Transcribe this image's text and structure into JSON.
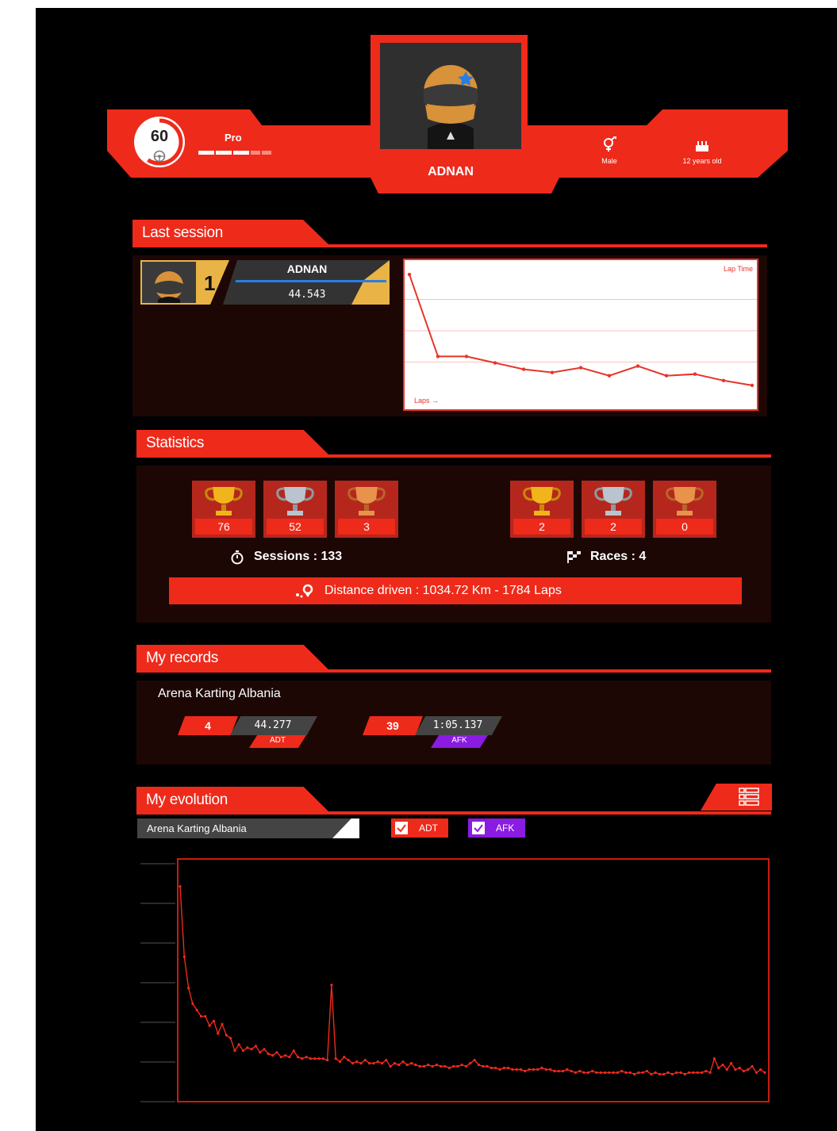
{
  "profile": {
    "name": "ADNAN",
    "level": "60",
    "rank": "Pro",
    "gender": "Male",
    "age": "12 years old"
  },
  "last_session": {
    "title": "Last session",
    "position": "1",
    "driver": "ADNAN",
    "best_lap": "44.543",
    "chart_data": {
      "type": "line",
      "ylabel": "Lap Time",
      "xlabel": "Laps",
      "x": [
        1,
        2,
        3,
        4,
        5,
        6,
        7,
        8,
        9,
        10,
        11,
        12,
        13
      ],
      "values": [
        51.8,
        46.7,
        46.7,
        46.3,
        45.9,
        45.7,
        46.0,
        45.5,
        46.1,
        45.5,
        45.6,
        45.2,
        44.9
      ],
      "ylim": [
        44.4,
        52.2
      ],
      "color": "#e8342a"
    }
  },
  "statistics": {
    "title": "Statistics",
    "sessions_trophies": [
      "76",
      "52",
      "3"
    ],
    "races_trophies": [
      "2",
      "2",
      "0"
    ],
    "sessions_label": "Sessions : 133",
    "races_label": "Races : 4",
    "distance_label": "Distance driven : 1034.72 Km - 1784 Laps"
  },
  "records": {
    "title": "My records",
    "track": "Arena Karting Albania",
    "items": [
      {
        "rank": "4",
        "time": "44.277",
        "tag": "ADT",
        "tag_color": "#ee2a1b"
      },
      {
        "rank": "39",
        "time": "1:05.137",
        "tag": "AFK",
        "tag_color": "#8a1be0"
      }
    ]
  },
  "evolution": {
    "title": "My evolution",
    "track_select": "Arena Karting Albania",
    "filters": [
      {
        "label": "ADT",
        "checked": true,
        "color": "#ee2a1b"
      },
      {
        "label": "AFK",
        "checked": true,
        "color": "#8a1be0"
      }
    ],
    "chart_data": {
      "type": "line",
      "series_color": "#ee2a1b",
      "values": [
        58.5,
        54.0,
        52.0,
        51.0,
        50.6,
        50.2,
        50.2,
        49.6,
        49.9,
        49.1,
        49.7,
        49.0,
        48.8,
        48.0,
        48.4,
        48.0,
        48.2,
        48.1,
        48.3,
        47.9,
        48.1,
        47.8,
        47.7,
        47.9,
        47.6,
        47.7,
        47.6,
        48.0,
        47.6,
        47.5,
        47.6,
        47.5,
        47.5,
        47.5,
        47.5,
        47.4,
        52.2,
        47.5,
        47.3,
        47.6,
        47.4,
        47.2,
        47.3,
        47.2,
        47.4,
        47.2,
        47.2,
        47.3,
        47.2,
        47.4,
        47.0,
        47.2,
        47.1,
        47.3,
        47.1,
        47.2,
        47.1,
        47.0,
        47.0,
        47.1,
        47.0,
        47.1,
        47.0,
        47.0,
        46.9,
        47.0,
        47.0,
        47.1,
        47.0,
        47.2,
        47.4,
        47.1,
        47.0,
        47.0,
        46.9,
        46.9,
        46.8,
        46.9,
        46.9,
        46.8,
        46.8,
        46.8,
        46.7,
        46.8,
        46.8,
        46.8,
        46.9,
        46.8,
        46.8,
        46.7,
        46.7,
        46.7,
        46.8,
        46.7,
        46.6,
        46.7,
        46.6,
        46.6,
        46.7,
        46.6,
        46.6,
        46.6,
        46.6,
        46.6,
        46.6,
        46.7,
        46.6,
        46.6,
        46.5,
        46.6,
        46.6,
        46.7,
        46.5,
        46.6,
        46.5,
        46.5,
        46.6,
        46.5,
        46.6,
        46.6,
        46.5,
        46.6,
        46.6,
        46.6,
        46.6,
        46.7,
        46.6,
        47.5,
        46.9,
        47.1,
        46.8,
        47.2,
        46.8,
        46.9,
        46.7,
        46.8,
        47.0,
        46.6,
        46.8,
        46.6
      ],
      "ylim": [
        45.0,
        60.0
      ]
    }
  }
}
